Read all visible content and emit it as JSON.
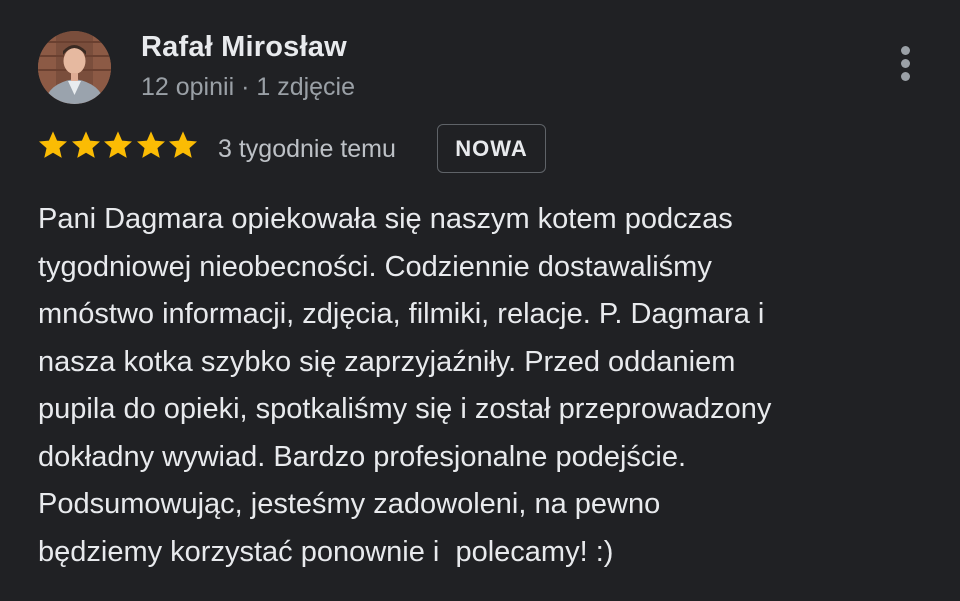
{
  "review": {
    "author": {
      "name": "Rafał Mirosław",
      "meta": "12 opinii · 1 zdjęcie"
    },
    "rating": {
      "stars": 5,
      "max": 5,
      "star_color": "#fbbc04",
      "date": "3 tygodnie temu"
    },
    "badge": "NOWA",
    "text_lines": [
      "Pani Dagmara opiekowała się naszym kotem podczas",
      "tygodniowej nieobecności. Codziennie dostawaliśmy",
      "mnóstwo informacji, zdjęcia, filmiki, relacje. P. Dagmara i",
      "nasza kotka szybko się zaprzyjaźniły. Przed oddaniem",
      "pupila do opieki, spotkaliśmy się i został przeprowadzony",
      "dokładny wywiad. Bardzo profesjonalne podejście.",
      "Podsumowując, jesteśmy zadowoleni, na pewno",
      "będziemy korzystać ponownie i  polecamy! :)"
    ],
    "more_icon": "more-vert-icon"
  },
  "theme": {
    "background": "#202124",
    "primary_text": "#e8eaed",
    "secondary_text": "#9aa0a6"
  }
}
